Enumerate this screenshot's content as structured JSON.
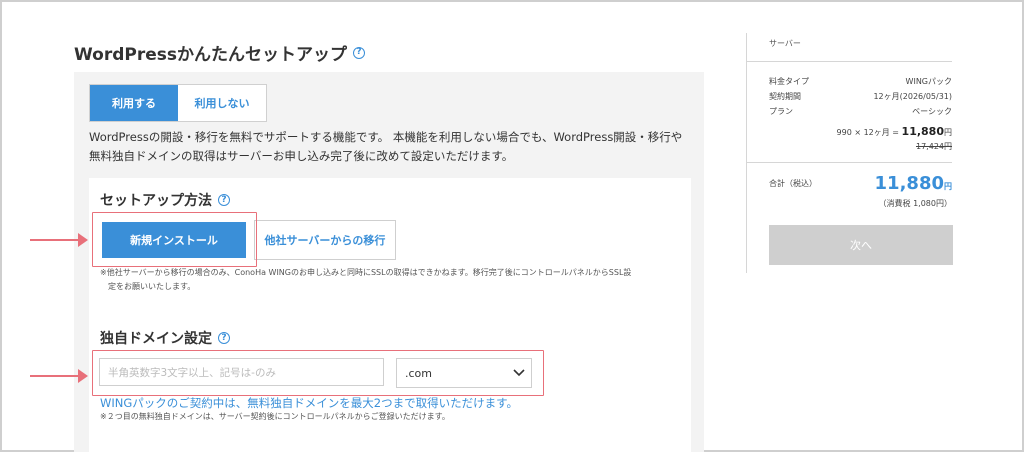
{
  "page": {
    "title": "WordPressかんたんセットアップ"
  },
  "wordpress_toggle": {
    "use_label": "利用する",
    "no_use_label": "利用しない",
    "selected": "利用する"
  },
  "description": {
    "line1": "WordPressの開設・移行を無料でサポートする機能です。 本機能を利用しない場合でも、WordPress開設・移行や",
    "line2": "無料独自ドメインの取得はサーバーお申し込み完了後に改めて設定いただけます。"
  },
  "setup_method": {
    "title": "セットアップ方法",
    "new_install_label": "新規インストール",
    "migrate_label": "他社サーバーからの移行",
    "note_line1": "※他社サーバーから移行の場合のみ、ConoHa WINGのお申し込みと同時にSSLの取得はできかねます。移行完了後にコントロールパネルからSSL設",
    "note_line2": "定をお願いいたします。"
  },
  "domain": {
    "title": "独自ドメイン設定",
    "input_placeholder": "半角英数字3文字以上、記号は-のみ",
    "tld_value": ".com",
    "promo": "WINGパックのご契約中は、無料独自ドメインを最大2つまで取得いただけます。",
    "note": "※２つ目の無料独自ドメインは、サーバー契約後にコントロールパネルからご登録いただけます。"
  },
  "sidebar": {
    "heading": "サーバー",
    "rows": [
      {
        "label": "料金タイプ",
        "value": "WINGパック"
      },
      {
        "label": "契約期間",
        "value": "12ヶ月(2026/05/31)"
      },
      {
        "label": "プラン",
        "value": "ベーシック"
      }
    ],
    "calc_prefix": "990 × 12ヶ月 = ",
    "calc_amount": "11,880",
    "calc_unit": "円",
    "strike_price": "17,424円",
    "total_label": "合計（税込）",
    "total_amount": "11,880",
    "total_unit": "円",
    "tax": "（消費税 1,080円）",
    "next_label": "次へ"
  },
  "colors": {
    "accent": "#3a8fd8",
    "highlight": "#e8707a",
    "disabled": "#cfcfcf"
  }
}
